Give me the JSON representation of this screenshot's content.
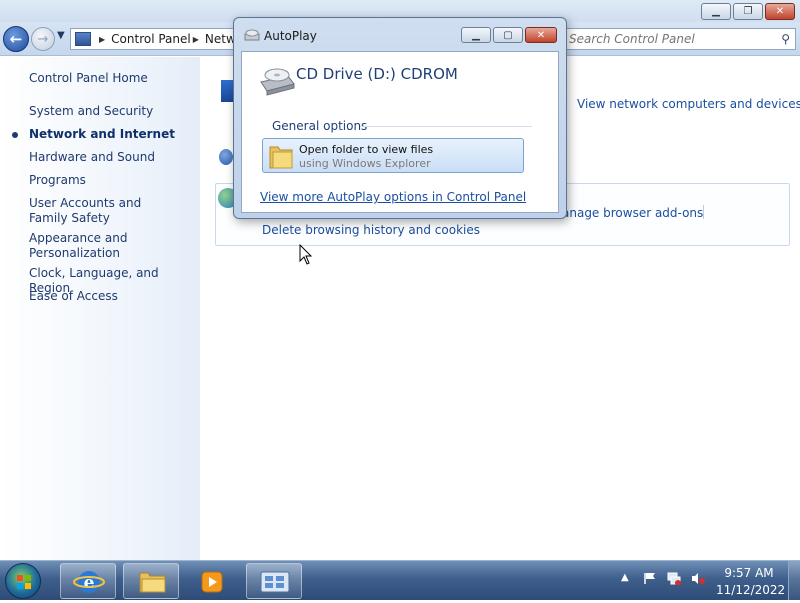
{
  "control_panel": {
    "breadcrumb": [
      "Control Panel",
      "Netw"
    ],
    "search_placeholder": "Search Control Panel",
    "sidebar": {
      "home": "Control Panel Home",
      "items": [
        {
          "label": "System and Security",
          "active": false
        },
        {
          "label": "Network and Internet",
          "active": true
        },
        {
          "label": "Hardware and Sound",
          "active": false
        },
        {
          "label": "Programs",
          "active": false
        },
        {
          "label": "User Accounts and Family Safety",
          "active": false
        },
        {
          "label": "Appearance and Personalization",
          "active": false
        },
        {
          "label": "Clock, Language, and Region",
          "active": false
        },
        {
          "label": "Ease of Access",
          "active": false
        }
      ]
    },
    "content": {
      "network_link": "View network computers and devices",
      "browser_links": [
        "anage browser add-ons",
        "Delete browsing history and cookies"
      ]
    }
  },
  "autoplay": {
    "title": "AutoPlay",
    "drive": "CD Drive (D:) CDROM",
    "section": "General options",
    "option": {
      "label": "Open folder to view files",
      "sublabel": "using Windows Explorer"
    },
    "more_link": "View more AutoPlay options in Control Panel"
  },
  "taskbar": {
    "time": "9:57 AM",
    "date": "11/12/2022",
    "pinned": [
      "internet-explorer",
      "windows-explorer",
      "windows-media-player",
      "control-panel"
    ],
    "tray_icons": [
      "show-hidden-icons",
      "action-center-flag",
      "network",
      "volume-muted"
    ]
  }
}
